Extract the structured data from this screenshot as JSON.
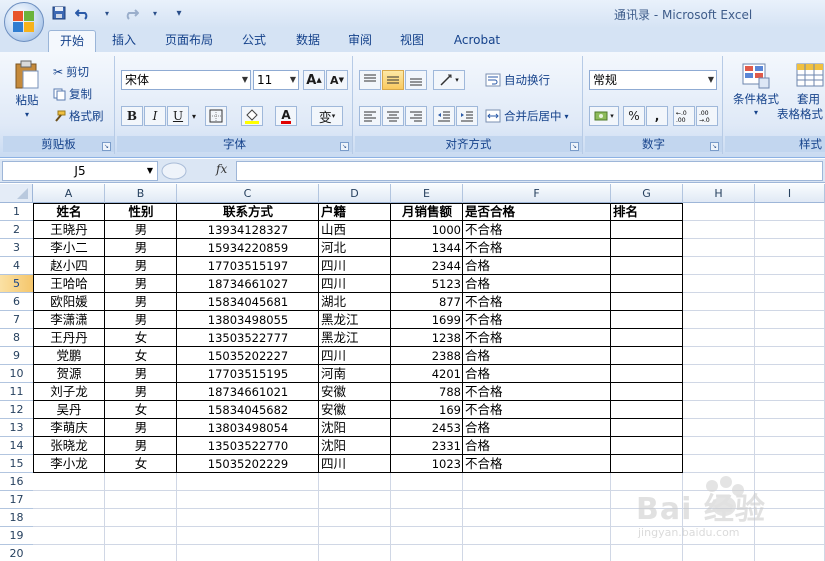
{
  "window": {
    "title": "通讯录 - Microsoft Excel"
  },
  "quick_access": {
    "icons": [
      "save-icon",
      "undo-icon",
      "redo-icon",
      "customize-icon"
    ]
  },
  "tabs": [
    {
      "label": "开始",
      "active": true
    },
    {
      "label": "插入"
    },
    {
      "label": "页面布局"
    },
    {
      "label": "公式"
    },
    {
      "label": "数据"
    },
    {
      "label": "审阅"
    },
    {
      "label": "视图"
    },
    {
      "label": "Acrobat"
    }
  ],
  "ribbon": {
    "clipboard": {
      "label": "剪贴板",
      "paste": "粘贴",
      "cut": "剪切",
      "copy": "复制",
      "format_painter": "格式刷"
    },
    "font": {
      "label": "字体",
      "font_name": "宋体",
      "font_size": "11",
      "bold": "B",
      "italic": "I",
      "underline": "U",
      "grow": "A",
      "shrink": "A",
      "font_color_glyph": "A",
      "phonetic": "变"
    },
    "alignment": {
      "label": "对齐方式",
      "wrap_text": "自动换行",
      "merge_center": "合并后居中"
    },
    "number": {
      "label": "数字",
      "format": "常规",
      "percent": "%",
      "comma": ","
    },
    "styles": {
      "label": "样式",
      "conditional": "条件格式",
      "table_format_1": "套用",
      "table_format_2": "表格格式"
    }
  },
  "formula_bar": {
    "name_box": "J5",
    "fx": "fx",
    "value": ""
  },
  "columns": [
    "A",
    "B",
    "C",
    "D",
    "E",
    "F",
    "G",
    "H",
    "I"
  ],
  "rows": [
    "1",
    "2",
    "3",
    "4",
    "5",
    "6",
    "7",
    "8",
    "9",
    "10",
    "11",
    "12",
    "13",
    "14",
    "15",
    "16",
    "17",
    "18",
    "19",
    "20"
  ],
  "selected_row": "5",
  "sheet": {
    "headers": [
      "姓名",
      "性别",
      "联系方式",
      "户籍",
      "月销售额",
      "是否合格",
      "排名"
    ],
    "records": [
      [
        "王晓丹",
        "男",
        "13934128327",
        "山西",
        "1000",
        "不合格"
      ],
      [
        "李小二",
        "男",
        "15934220859",
        "河北",
        "1344",
        "不合格"
      ],
      [
        "赵小四",
        "男",
        "17703515197",
        "四川",
        "2344",
        "合格"
      ],
      [
        "王哈哈",
        "男",
        "18734661027",
        "四川",
        "5123",
        "合格"
      ],
      [
        "欧阳媛",
        "男",
        "15834045681",
        "湖北",
        "877",
        "不合格"
      ],
      [
        "李潇潇",
        "男",
        "13803498055",
        "黑龙江",
        "1699",
        "不合格"
      ],
      [
        "王丹丹",
        "女",
        "13503522777",
        "黑龙江",
        "1238",
        "不合格"
      ],
      [
        "党鹏",
        "女",
        "15035202227",
        "四川",
        "2388",
        "合格"
      ],
      [
        "贺源",
        "男",
        "17703515195",
        "河南",
        "4201",
        "合格"
      ],
      [
        "刘子龙",
        "男",
        "18734661021",
        "安徽",
        "788",
        "不合格"
      ],
      [
        "吴丹",
        "女",
        "15834045682",
        "安徽",
        "169",
        "不合格"
      ],
      [
        "李萌庆",
        "男",
        "13803498054",
        "沈阳",
        "2453",
        "合格"
      ],
      [
        "张晓龙",
        "男",
        "13503522770",
        "沈阳",
        "2331",
        "合格"
      ],
      [
        "李小龙",
        "女",
        "15035202229",
        "四川",
        "1023",
        "不合格"
      ]
    ]
  },
  "watermark": {
    "text": "Bai 经验",
    "sub": "jingyan.baidu.com"
  }
}
